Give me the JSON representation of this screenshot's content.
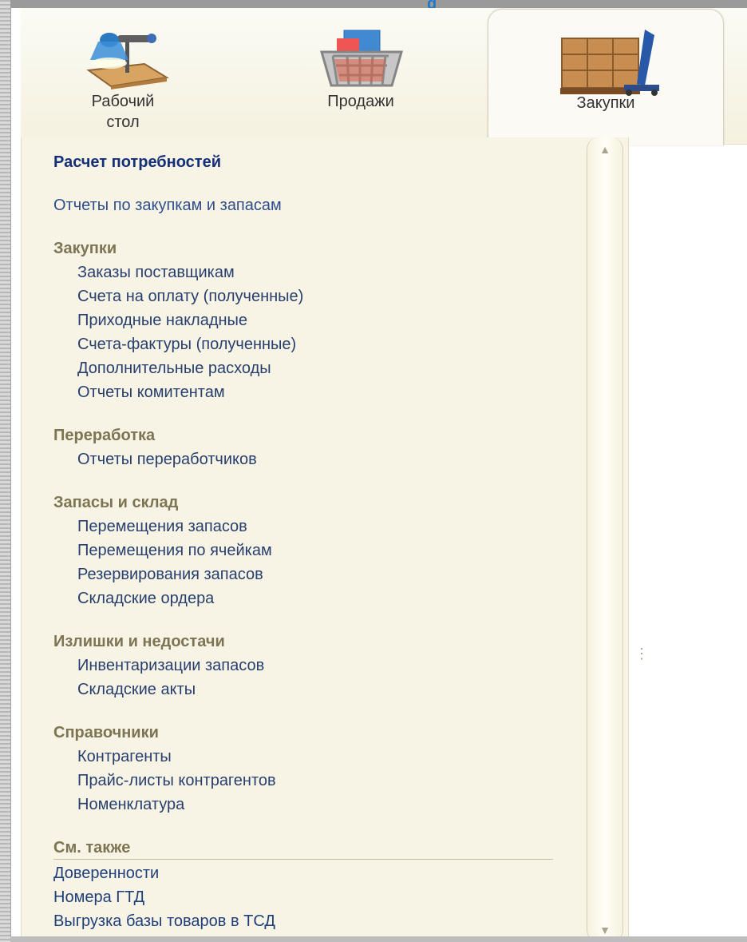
{
  "header": {
    "title_fragment": "g"
  },
  "sections": [
    {
      "label": "Рабочий\nстол",
      "icon": "desk-lamp-icon"
    },
    {
      "label": "Продажи",
      "icon": "shopping-basket-icon"
    },
    {
      "label": "Закупки",
      "icon": "pallet-truck-icon",
      "active": true
    }
  ],
  "menu": {
    "primary": "Расчет потребностей",
    "reports": "Отчеты по закупкам и запасам",
    "groups": [
      {
        "title": "Закупки",
        "items": [
          "Заказы поставщикам",
          "Счета на оплату (полученные)",
          "Приходные накладные",
          "Счета-фактуры (полученные)",
          "Дополнительные расходы",
          "Отчеты комитентам"
        ]
      },
      {
        "title": "Переработка",
        "items": [
          "Отчеты переработчиков"
        ]
      },
      {
        "title": "Запасы и склад",
        "items": [
          "Перемещения запасов",
          "Перемещения по ячейкам",
          "Резервирования запасов",
          "Складские ордера"
        ]
      },
      {
        "title": "Излишки и недостачи",
        "items": [
          "Инвентаризации запасов",
          "Складские акты"
        ]
      },
      {
        "title": "Справочники",
        "items": [
          "Контрагенты",
          "Прайс-листы контрагентов",
          "Номенклатура"
        ]
      }
    ],
    "see_also": {
      "title": "См. также",
      "items": [
        "Доверенности",
        "Номера ГТД",
        "Выгрузка базы товаров в ТСД"
      ]
    }
  },
  "scrollbar": {
    "up": "▲",
    "down": "▼"
  },
  "splitter": "⋮"
}
